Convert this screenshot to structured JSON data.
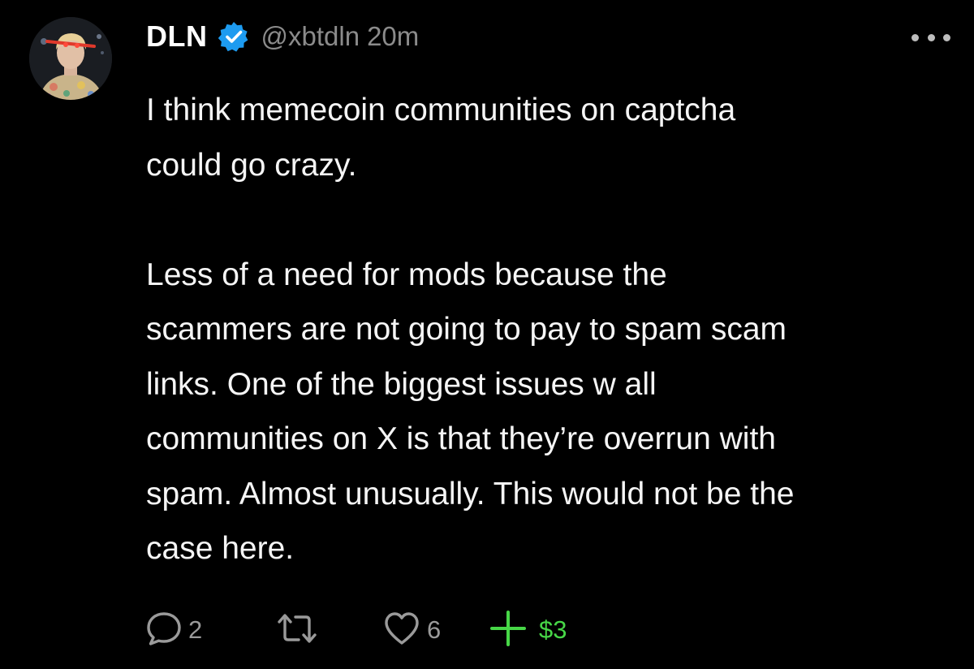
{
  "post": {
    "author": {
      "display_name": "DLN",
      "handle": "@xbtdln",
      "verified": true
    },
    "time": "20m",
    "text": {
      "paragraph_1": "I think memecoin communities on captcha\ncould go crazy.",
      "paragraph_2": "Less of a need for mods because the\nscammers are not going to pay to spam scam\nlinks. One of the biggest issues w all\ncommunities on X is that they’re overrun with\nspam. Almost unusually. This would not be the\ncase here."
    },
    "actions": {
      "replies": "2",
      "reposts": "",
      "likes": "6",
      "tips": "$3"
    }
  },
  "icons": {
    "avatar": "profile-photo",
    "verified": "verified-badge-icon",
    "more": "more-horizontal-icon",
    "reply": "comment-bubble-icon",
    "repost": "repost-arrows-icon",
    "like": "heart-icon",
    "tip": "plus-icon"
  },
  "colors": {
    "background": "#000000",
    "text": "#f5f5f5",
    "muted": "#8b8b8b",
    "verified": "#1d9bf0",
    "tip": "#47d747"
  }
}
